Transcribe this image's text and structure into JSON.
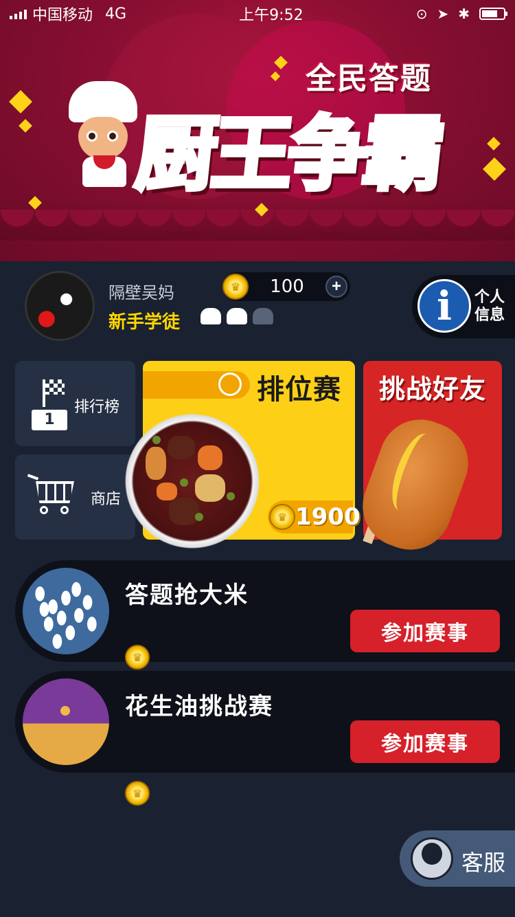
{
  "status_bar": {
    "carrier": "中国移动",
    "network": "4G",
    "time": "上午9:52"
  },
  "header": {
    "title_small": "全民答题",
    "title_main": "厨王争霸"
  },
  "profile": {
    "username": "隔壁吴妈",
    "rank": "新手学徒",
    "chef_hats_earned": 2,
    "chef_hats_total": 3,
    "coins": "100",
    "info_label": "个人信息"
  },
  "tiles": {
    "ranking_label": "排行榜",
    "ranking_podium": "1",
    "shop_label": "商店"
  },
  "ranked_match": {
    "title": "排位赛",
    "cost": "1900"
  },
  "challenge_friends": {
    "title": "挑战好友"
  },
  "events": [
    {
      "title": "答题抢大米",
      "button": "参加赛事"
    },
    {
      "title": "花生油挑战赛",
      "button": "参加赛事"
    }
  ],
  "customer_service": {
    "label": "客服"
  },
  "colors": {
    "banner": "#8a0f32",
    "background": "#1a2130",
    "accent_yellow": "#fdd017",
    "accent_red": "#d6202a",
    "gold": "#ffd700"
  }
}
